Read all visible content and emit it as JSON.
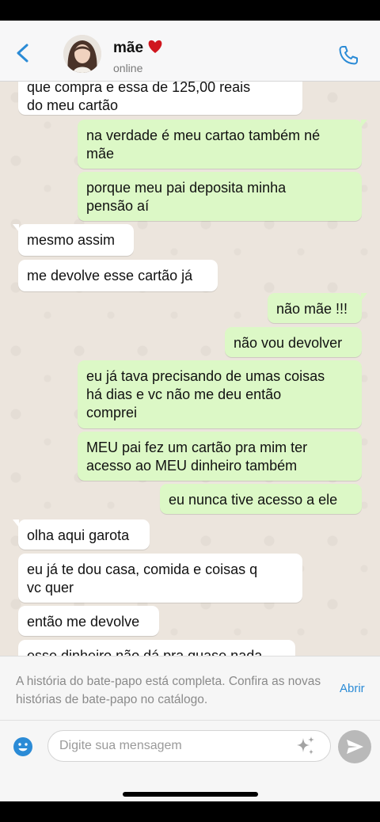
{
  "header": {
    "contact_name": "mãe",
    "status": "online"
  },
  "messages": [
    {
      "side": "in",
      "text": "que compra e essa de 125,00 reais\ndo meu cartão"
    },
    {
      "side": "out",
      "text": "na verdade é meu cartao também né\nmãe"
    },
    {
      "side": "out",
      "text": "porque meu pai deposita minha\npensão aí"
    },
    {
      "side": "in",
      "text": "mesmo assim"
    },
    {
      "side": "in",
      "text": "me devolve esse cartão já"
    },
    {
      "side": "out",
      "text": "não mãe !!!"
    },
    {
      "side": "out",
      "text": "não vou devolver"
    },
    {
      "side": "out",
      "text": "eu já tava precisando de umas coisas\nhá dias e vc não me deu então\ncomprei"
    },
    {
      "side": "out",
      "text": "MEU pai fez um cartão pra mim ter\nacesso ao MEU dinheiro também"
    },
    {
      "side": "out",
      "text": "eu nunca tive acesso a ele"
    },
    {
      "side": "in",
      "text": "olha aqui garota"
    },
    {
      "side": "in",
      "text": "eu já te dou casa, comida e coisas q\nvc quer"
    },
    {
      "side": "in",
      "text": "então me devolve"
    },
    {
      "side": "in",
      "text": "esse dinheiro não dá pra quase nada"
    }
  ],
  "banner": {
    "text": "A história do bate-papo está completa. Confira as novas histórias de bate-papo no catálogo.",
    "link": "Abrir"
  },
  "input": {
    "placeholder": "Digite sua mensagem",
    "value": ""
  },
  "colors": {
    "outgoing_bubble": "#dcf8c6",
    "incoming_bubble": "#ffffff",
    "accent": "#2b8bd6",
    "chat_background": "#ece5dd"
  },
  "icons": [
    "back-icon",
    "heart-icon",
    "phone-icon",
    "emoji-icon",
    "sparkle-icon",
    "send-icon"
  ]
}
